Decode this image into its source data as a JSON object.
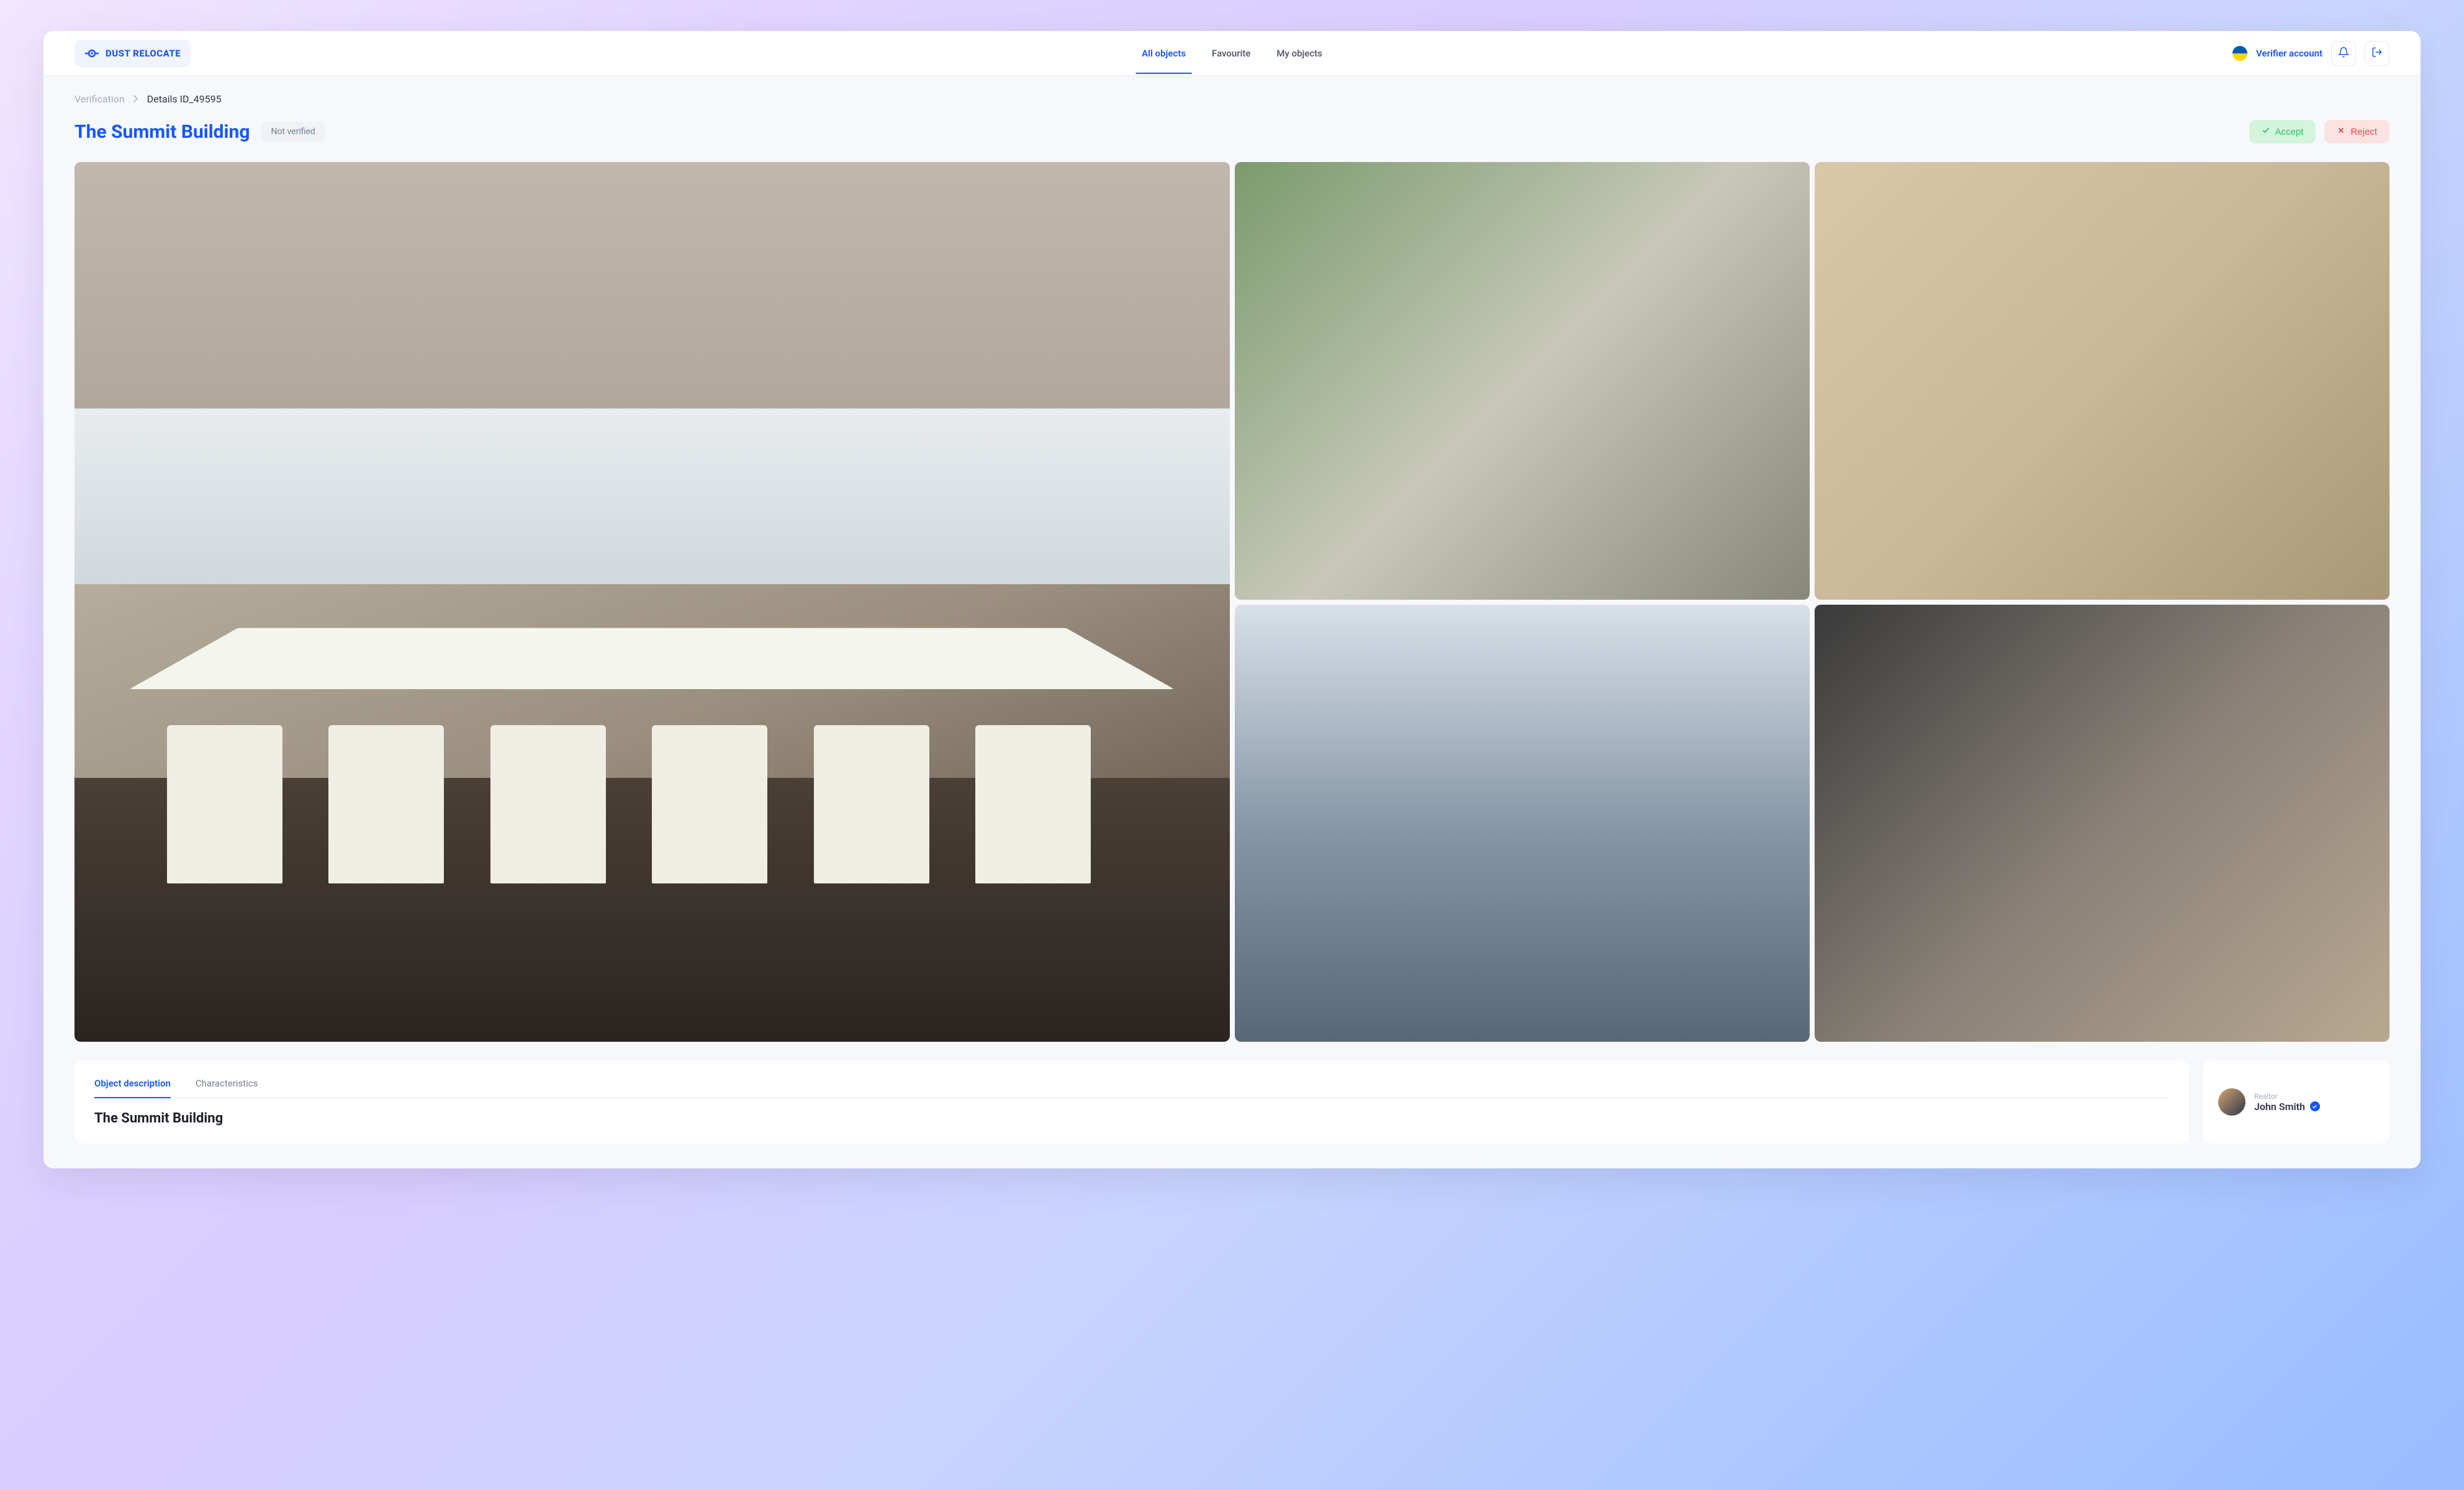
{
  "brand": {
    "name": "DUST RELOCATE"
  },
  "nav": {
    "items": [
      {
        "label": "All objects",
        "active": true
      },
      {
        "label": "Favourite",
        "active": false
      },
      {
        "label": "My objects",
        "active": false
      }
    ]
  },
  "header": {
    "account_label": "Verifier account"
  },
  "breadcrumb": {
    "items": [
      {
        "label": "Verification",
        "current": false
      },
      {
        "label": "Details ID_49595",
        "current": true
      }
    ]
  },
  "page": {
    "title": "The Summit Building",
    "status": "Not verified",
    "section_heading": "The Summit Building"
  },
  "actions": {
    "accept": "Accept",
    "reject": "Reject"
  },
  "tabs": [
    {
      "label": "Object description",
      "active": true
    },
    {
      "label": "Characteristics",
      "active": false
    }
  ],
  "realtor": {
    "role_label": "Realtor",
    "name": "John Smith"
  },
  "colors": {
    "primary": "#1556ff",
    "accept_bg": "#d4f4dd",
    "accept_fg": "#22c55e",
    "reject_bg": "#fde2e2",
    "reject_fg": "#ef4444"
  }
}
